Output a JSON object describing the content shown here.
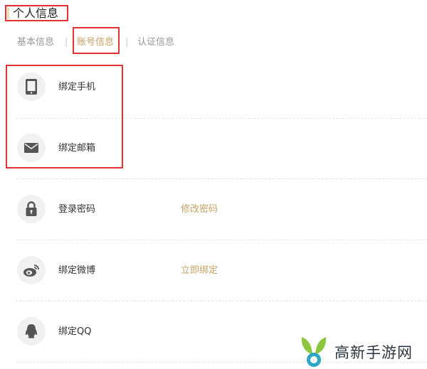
{
  "header": {
    "title": "个人信息"
  },
  "tabs": [
    {
      "label": "基本信息",
      "active": false
    },
    {
      "label": "账号信息",
      "active": true
    },
    {
      "label": "认证信息",
      "active": false
    }
  ],
  "tab_separator": "|",
  "rows": [
    {
      "label": "绑定手机",
      "icon": "phone-icon",
      "action": ""
    },
    {
      "label": "绑定邮箱",
      "icon": "mail-icon",
      "action": ""
    },
    {
      "label": "登录密码",
      "icon": "lock-icon",
      "action": "修改密码"
    },
    {
      "label": "绑定微博",
      "icon": "weibo-icon",
      "action": "立即绑定"
    },
    {
      "label": "绑定QQ",
      "icon": "qq-icon",
      "action": ""
    }
  ],
  "watermark": {
    "text": "高新手游网"
  },
  "colors": {
    "accent": "#c8a264",
    "highlight": "#e23232",
    "icon": "#555555"
  }
}
